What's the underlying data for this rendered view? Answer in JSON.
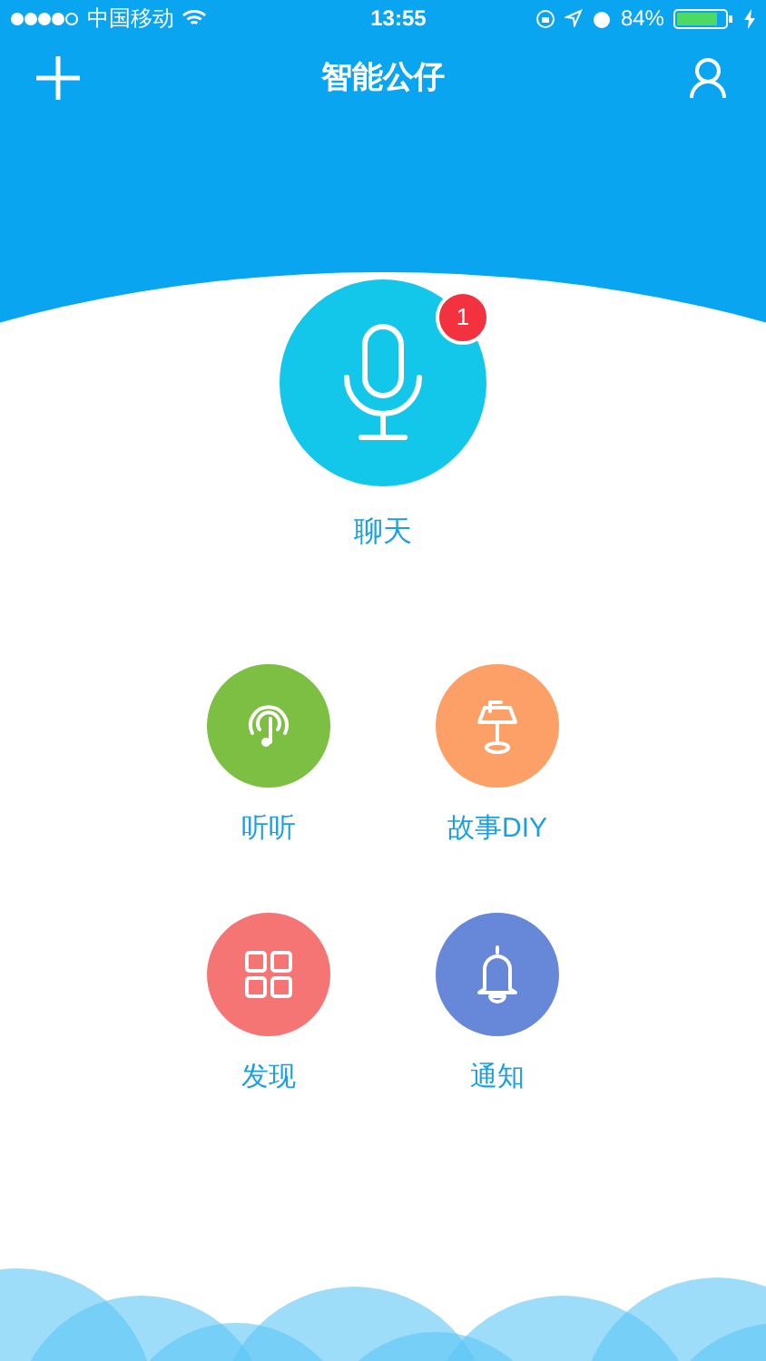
{
  "status_bar": {
    "carrier": "中国移动",
    "time": "13:55",
    "battery": "84%"
  },
  "nav": {
    "title": "智能公仔"
  },
  "chat": {
    "label": "聊天",
    "badge": "1"
  },
  "features": [
    {
      "label": "听听",
      "kind": "music",
      "color": "#7cbf43"
    },
    {
      "label": "故事DIY",
      "kind": "lamp",
      "color": "#fda068"
    },
    {
      "label": "发现",
      "kind": "grid",
      "color": "#f57575"
    },
    {
      "label": "通知",
      "kind": "bell",
      "color": "#6787d8"
    }
  ]
}
